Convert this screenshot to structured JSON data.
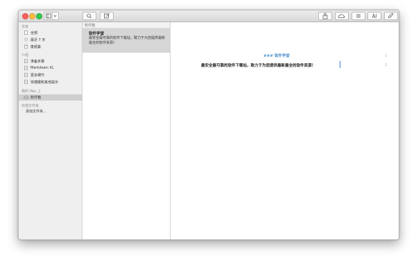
{
  "titlebar": {
    "left_buttons": [
      "sidebar-toggle",
      "search",
      "compose"
    ],
    "right_buttons": [
      "share",
      "icloud",
      "list-view",
      "typography",
      "attach"
    ]
  },
  "sidebar": {
    "section1_title": "文库",
    "section1_items": [
      {
        "label": "全部",
        "icon": "document-icon"
      },
      {
        "label": "最近 7 天",
        "icon": "clock-icon"
      },
      {
        "label": "废纸篓",
        "icon": "trash-icon"
      }
    ],
    "section2_title": "介绍",
    "section2_items": [
      {
        "label": "准备步骤",
        "icon": "document-icon"
      },
      {
        "label": "Markdown XL",
        "icon": "document-icon"
      },
      {
        "label": "更多细节",
        "icon": "document-icon"
      },
      {
        "label": "快捷键和其他提示",
        "icon": "document-icon"
      }
    ],
    "section3_title": "我的 Mac 上",
    "section3_items": [
      {
        "label": "软件箱",
        "icon": "cloud-icon",
        "selected": true
      }
    ],
    "section4_title": "外部文件夹",
    "section4_add": "添加文件夹..."
  },
  "list": {
    "header": "软件箱",
    "items": [
      {
        "title": "软件学堂",
        "body": "最安全最可靠的软件下载站，致力于为您提供最新最全的软件资源！"
      }
    ]
  },
  "editor": {
    "lines": [
      {
        "num": "1",
        "text": "### 软件学堂"
      },
      {
        "num": "2",
        "text": "最安全最可靠的软件下载站，致力于为您提供最新最全的软件资源！"
      }
    ]
  }
}
